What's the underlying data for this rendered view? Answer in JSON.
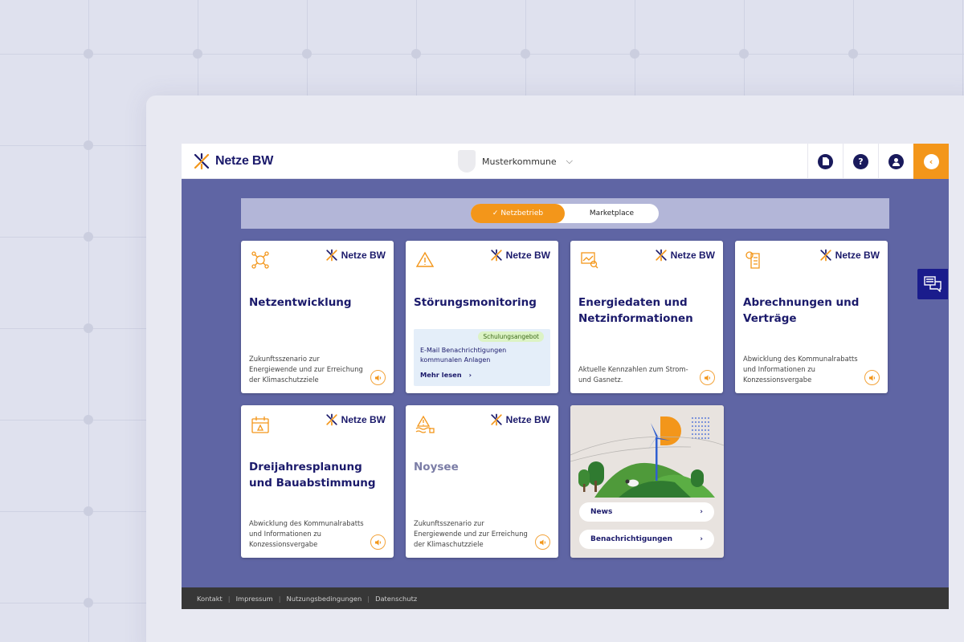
{
  "header": {
    "brand": "Netze BW",
    "tenant": "Musterkommune",
    "icons": [
      "document-icon",
      "help-icon",
      "user-icon",
      "collapse-icon"
    ]
  },
  "tabs": [
    {
      "label": "✓ Netzbetrieb",
      "active": true
    },
    {
      "label": "Marketplace",
      "active": false
    }
  ],
  "cards": [
    {
      "brand": "Netze BW",
      "title": "Netzentwicklung",
      "desc": "Zukunftsszenario zur Energiewende und zur Erreichung der Klimaschutzziele",
      "icon": "network-icon"
    },
    {
      "brand": "Netze BW",
      "title": "Störungsmonitoring",
      "badge": "Schulungsangebot",
      "info": "E-Mail Benachrichtigungen kommunalen Anlagen",
      "more": "Mehr lesen",
      "icon": "warning-icon"
    },
    {
      "brand": "Netze BW",
      "title": "Energiedaten und Netzinformationen",
      "desc": "Aktuelle Kennzahlen zum Strom- und Gasnetz.",
      "icon": "chart-search-icon"
    },
    {
      "brand": "Netze BW",
      "title": "Abrechnungen und Verträge",
      "desc": "Abwicklung des Kommunalrabatts und Informationen zu Konzessionsvergabe",
      "icon": "billing-icon"
    },
    {
      "brand": "Netze BW",
      "title": "Dreijahresplanung und Bauabstimmung",
      "desc": "Abwicklung des Kommunalrabatts und Informationen zu Konzessionsvergabe",
      "icon": "calendar-icon"
    },
    {
      "brand": "Netze BW",
      "title": "Noysee",
      "desc": "Zukunftsszenario zur Energiewende und zur Erreichung der Klimaschutzziele",
      "icon": "flood-warning-icon"
    }
  ],
  "news": {
    "items": [
      {
        "label": "News"
      },
      {
        "label": "Benachrichtigungen"
      }
    ]
  },
  "footer": {
    "links": [
      "Kontakt",
      "Impressum",
      "Nutzungsbedingungen",
      "Datenschutz"
    ]
  },
  "colors": {
    "accent": "#f3961a",
    "brand": "#1b1a6b",
    "app_bg": "#5f65a4",
    "footer_bg": "#373737"
  }
}
